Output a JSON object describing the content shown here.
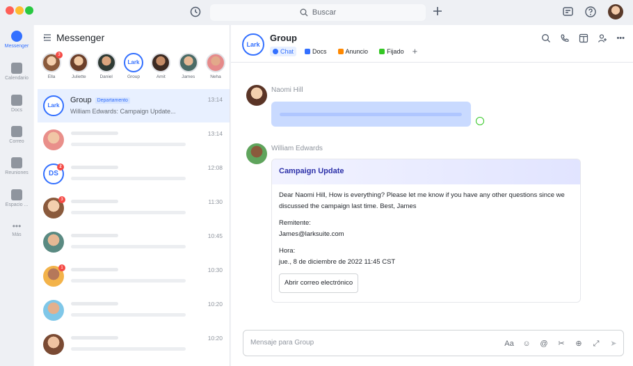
{
  "titlebar": {
    "search_placeholder": "Buscar"
  },
  "rail": {
    "items": [
      {
        "label": "Messenger",
        "icon": "chat-bubble-icon",
        "active": true
      },
      {
        "label": "Calendario",
        "icon": "calendar-icon"
      },
      {
        "label": "Docs",
        "icon": "docs-icon"
      },
      {
        "label": "Correo",
        "icon": "mail-icon"
      },
      {
        "label": "Reuniones",
        "icon": "video-icon"
      },
      {
        "label": "Espacio ...",
        "icon": "apps-grid-icon"
      },
      {
        "label": "Más",
        "icon": "more-dots-icon"
      }
    ]
  },
  "messenger": {
    "title": "Messenger",
    "pinned": [
      {
        "name": "Ella",
        "badge": "3"
      },
      {
        "name": "Juliette",
        "badge": ""
      },
      {
        "name": "Daniel",
        "badge": ""
      },
      {
        "name": "Group",
        "badge": "",
        "logo": "Lark"
      },
      {
        "name": "Amit",
        "badge": ""
      },
      {
        "name": "James",
        "badge": ""
      },
      {
        "name": "Neha",
        "badge": ""
      }
    ],
    "chats": [
      {
        "name": "Group",
        "tag": "Departamento",
        "preview": "William Edwards: Campaign Update...",
        "time": "13:14",
        "logo": "Lark"
      },
      {
        "time": "13:14",
        "badge": ""
      },
      {
        "time": "12:08",
        "badge": "2",
        "initials": "DS"
      },
      {
        "time": "11:30",
        "badge": "3"
      },
      {
        "time": "10:45",
        "badge": ""
      },
      {
        "time": "10:30",
        "badge": "1"
      },
      {
        "time": "10:20",
        "badge": ""
      },
      {
        "time": "10:20",
        "badge": ""
      }
    ]
  },
  "chat": {
    "title": "Group",
    "logo": "Lark",
    "tabs": [
      {
        "label": "Chat",
        "active": true
      },
      {
        "label": "Docs"
      },
      {
        "label": "Anuncio"
      },
      {
        "label": "Fijado"
      }
    ],
    "messages": {
      "first_sender": "Naomi Hill",
      "second_sender": "William Edwards"
    },
    "card": {
      "title": "Campaign Update",
      "body": "Dear Naomi Hill, How is everything? Please let me know if you have any other questions since we discussed the campaign last time. Best, James",
      "sender_label": "Remitente:",
      "sender_value": "James@larksuite.com",
      "time_label": "Hora:",
      "time_value": "jue., 8 de diciembre de 2022 11:45 CST",
      "button": "Abrir correo electrónico"
    },
    "composer": {
      "placeholder": "Mensaje para Group"
    }
  },
  "colors": {
    "accent": "#3370ff",
    "badge": "#f54a45"
  }
}
